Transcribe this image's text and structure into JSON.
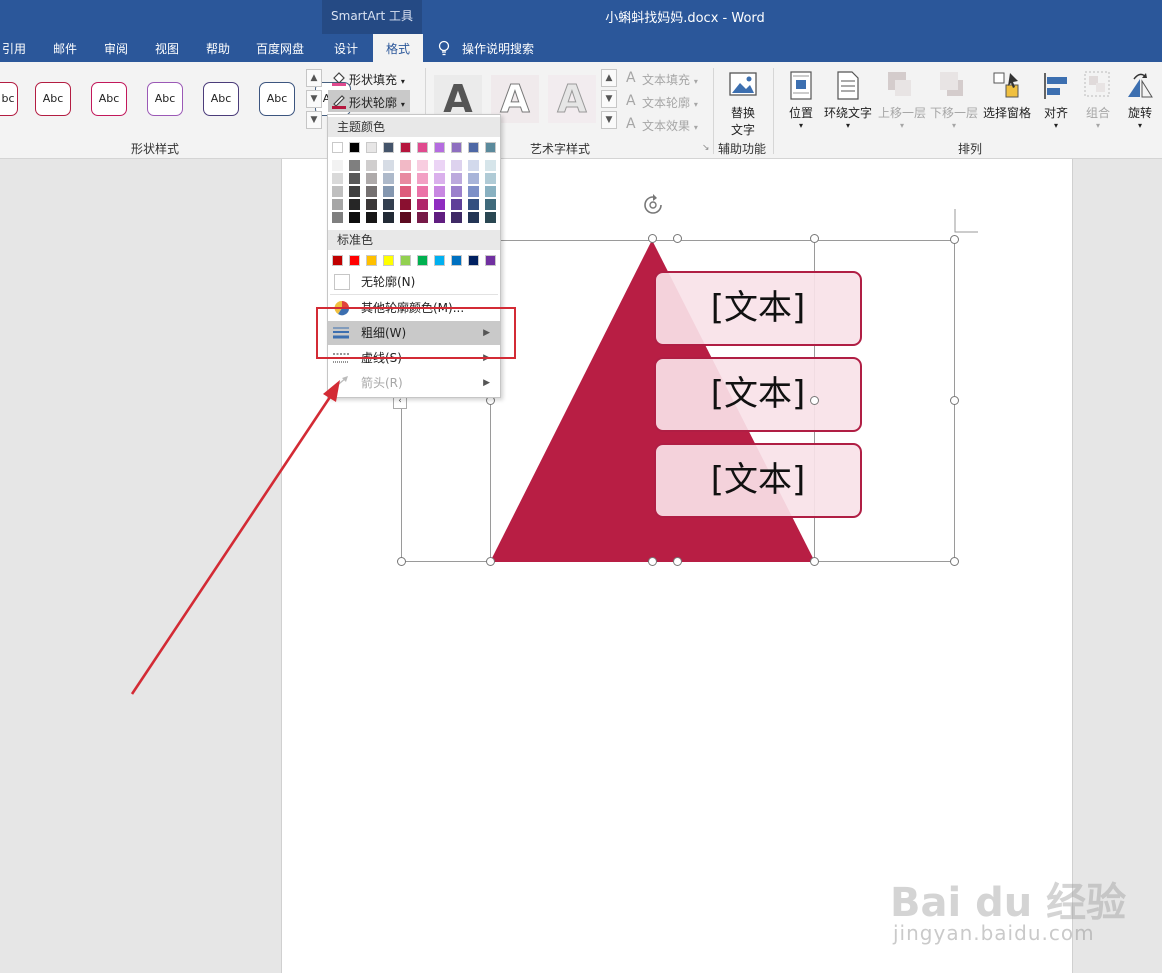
{
  "titlebar": {
    "context_tab": "SmartArt 工具",
    "doc_title": "小蝌蚪找妈妈.docx  -  Word"
  },
  "tabs": {
    "references": "引用",
    "mailings": "邮件",
    "review": "审阅",
    "view": "视图",
    "help": "帮助",
    "baidu": "百度网盘",
    "design": "设计",
    "format": "格式",
    "tell_me": "操作说明搜索"
  },
  "ribbon": {
    "shape_styles": {
      "group_label": "形状样式",
      "samples": [
        "Abc",
        "Abc",
        "Abc",
        "Abc",
        "Abc",
        "Abc"
      ],
      "sample_colors": [
        "#b31d42",
        "#c2185b",
        "#9b59b6",
        "#4b3c7a",
        "#3c557f",
        "#476080"
      ],
      "first_partial": "bc",
      "fill": "形状填充",
      "outline": "形状轮廓"
    },
    "wordart": {
      "group_label": "艺术字样式",
      "sample_letter": "A",
      "text_fill": "文本填充",
      "text_outline": "文本轮廓",
      "text_effects": "文本效果"
    },
    "accessibility": {
      "group_label": "辅助功能",
      "alt_text_line1": "替换",
      "alt_text_line2": "文字"
    },
    "arrange": {
      "group_label": "排列",
      "position": "位置",
      "wrap_text": "环绕文字",
      "bring_forward": "上移一层",
      "send_backward": "下移一层",
      "selection_pane": "选择窗格",
      "align": "对齐",
      "group": "组合",
      "rotate": "旋转"
    }
  },
  "menu": {
    "theme_colors_label": "主题颜色",
    "theme_top_row": [
      "#ffffff",
      "#000000",
      "#e7e6e6",
      "#44546a",
      "#b5163d",
      "#e04a8e",
      "#b56ce0",
      "#8e6fc0",
      "#4e68a5",
      "#5b8a9c"
    ],
    "theme_shades": [
      [
        "#f2f2f2",
        "#7f7f7f",
        "#d0cece",
        "#d6dce5",
        "#f2b9c6",
        "#f8cde0",
        "#ebd4f5",
        "#ddd2ee",
        "#d2d9ec",
        "#d6e5ea"
      ],
      [
        "#d9d9d9",
        "#595959",
        "#aeaaaa",
        "#adb9ca",
        "#e88aa0",
        "#f2a0c4",
        "#dab0ec",
        "#bca9dd",
        "#a8b4d9",
        "#b0cbd6"
      ],
      [
        "#bfbfbf",
        "#404040",
        "#757171",
        "#8497b0",
        "#de5c7c",
        "#eb73a8",
        "#c887e2",
        "#9b80cc",
        "#7d90c7",
        "#89b1c1"
      ],
      [
        "#a6a6a6",
        "#262626",
        "#3b3838",
        "#333f50",
        "#8a1030",
        "#b0266a",
        "#8f2cc0",
        "#5e3f99",
        "#344f7f",
        "#3f6a7b"
      ],
      [
        "#7f7f7f",
        "#0d0d0d",
        "#171616",
        "#222a35",
        "#5c0b20",
        "#761a47",
        "#601d80",
        "#3f2a66",
        "#233555",
        "#2a4752"
      ]
    ],
    "standard_label": "标准色",
    "standard_colors": [
      "#c00000",
      "#ff0000",
      "#ffc000",
      "#ffff00",
      "#92d050",
      "#00b050",
      "#00b0f0",
      "#0070c0",
      "#002060",
      "#7030a0"
    ],
    "no_outline": "无轮廓(N)",
    "more_colors": "其他轮廓颜色(M)...",
    "weight": "粗细(W)",
    "dashes": "虚线(S)",
    "arrows": "箭头(R)"
  },
  "document": {
    "boxes": [
      "[文本]",
      "[文本]",
      "[文本]"
    ],
    "triangle_color": "#b81e44"
  },
  "watermark": {
    "brand": "Bai du 经验",
    "url": "jingyan.baidu.com"
  },
  "annotation_color": "#d32b35"
}
